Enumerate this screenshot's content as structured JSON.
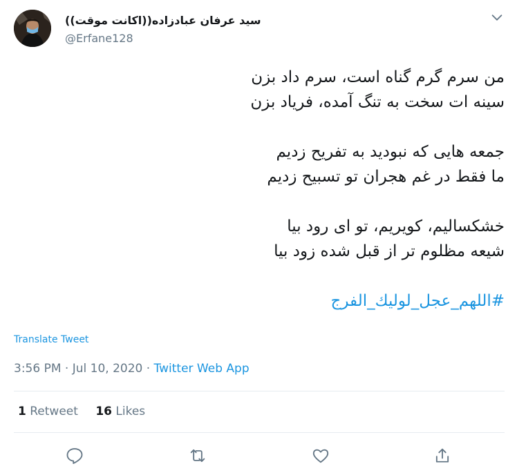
{
  "user": {
    "display_name": "سید عرفان عبادزاده((اکانت موقت))",
    "handle": "@Erfane128"
  },
  "tweet": {
    "lines": [
      "من سرم گرم گناه است، سرم داد بزن",
      "سینه ات سخت به تنگ آمده، فریاد بزن",
      "",
      "جمعه هایی که نبودید به تفریح زدیم",
      "ما فقط در غم هجران تو تسبیح زدیم",
      "",
      "خشکسالیم، کویریم، تو ای رود بیا",
      "شیعه مظلوم تر از قبل شده زود بیا",
      ""
    ],
    "hashtag": "#اللهم_عجل_لوليك_الفرج"
  },
  "translate_label": "Translate Tweet",
  "meta": {
    "timestamp": "3:56 PM · Jul 10, 2020 · ",
    "source": "Twitter Web App"
  },
  "stats": {
    "retweets_count": "1",
    "retweets_label": "Retweet",
    "likes_count": "16",
    "likes_label": "Likes"
  },
  "colors": {
    "link": "#1b95e0",
    "secondary": "#657786",
    "icon": "#657786"
  },
  "icons": {
    "menu": "chevron-down-icon",
    "reply": "reply-icon",
    "retweet": "retweet-icon",
    "like": "heart-icon",
    "share": "share-icon"
  }
}
